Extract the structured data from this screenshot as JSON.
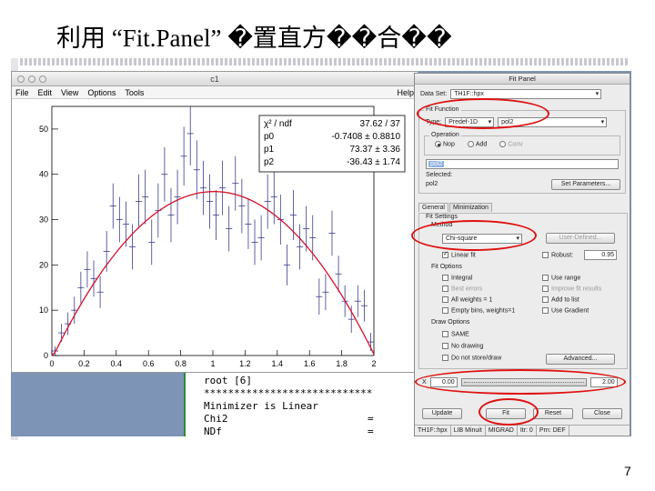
{
  "slide": {
    "title": "利用 “Fit.Panel” �置直方��合��",
    "page_number": "7"
  },
  "canvas_window": {
    "title": "c1",
    "menu": [
      "File",
      "Edit",
      "View",
      "Options",
      "Tools"
    ],
    "help": "Help"
  },
  "stats_box": {
    "rows": [
      {
        "label": "χ² / ndf",
        "value": "37.62 / 37"
      },
      {
        "label": "p0",
        "value": "-0.7408 ± 0.8810"
      },
      {
        "label": "p1",
        "value": "73.37 ± 3.36"
      },
      {
        "label": "p2",
        "value": "-36.43 ± 1.74"
      }
    ]
  },
  "chart_data": {
    "type": "scatter",
    "title": "",
    "xlabel": "",
    "ylabel": "",
    "xlim": [
      0,
      2
    ],
    "ylim": [
      0,
      55
    ],
    "x_ticks": [
      "0",
      "0.2",
      "0.4",
      "0.6",
      "0.8",
      "1",
      "1.2",
      "1.4",
      "1.6",
      "1.8",
      "2"
    ],
    "y_ticks": [
      "0",
      "10",
      "20",
      "30",
      "40",
      "50"
    ],
    "series": [
      {
        "x": [
          0.02,
          0.06,
          0.1,
          0.14,
          0.18,
          0.22,
          0.26,
          0.3,
          0.34,
          0.38,
          0.42,
          0.46,
          0.5,
          0.54,
          0.58,
          0.62,
          0.66,
          0.7,
          0.74,
          0.78,
          0.82,
          0.86,
          0.9,
          0.94,
          0.98,
          1.02,
          1.06,
          1.1,
          1.14,
          1.18,
          1.22,
          1.26,
          1.3,
          1.34,
          1.38,
          1.42,
          1.46,
          1.5,
          1.54,
          1.58,
          1.62,
          1.66,
          1.7,
          1.74,
          1.78,
          1.82,
          1.86,
          1.9,
          1.94,
          1.98
        ],
        "y": [
          1,
          5,
          7,
          10,
          15,
          19,
          17,
          14,
          23,
          33,
          30,
          29,
          24,
          34,
          35,
          25,
          32,
          40,
          31,
          35,
          44,
          49,
          41,
          37,
          34,
          31,
          37,
          28,
          38,
          33,
          29,
          25,
          26,
          34,
          35,
          30,
          20,
          31,
          24,
          28,
          26,
          13,
          14,
          27,
          18,
          12,
          8,
          12,
          11,
          3
        ],
        "err": [
          1,
          2,
          2.5,
          3,
          3.5,
          4,
          4,
          3.5,
          4.5,
          5,
          5,
          5,
          5,
          6,
          6,
          5,
          6,
          6,
          6,
          6,
          6.5,
          7,
          6.5,
          6,
          6,
          5.5,
          6,
          5,
          6,
          6,
          5.5,
          5,
          5,
          6,
          6,
          5.5,
          4.5,
          5.5,
          5,
          5,
          5,
          4,
          4,
          5,
          4,
          3.5,
          3,
          3.5,
          3.5,
          2
        ]
      }
    ],
    "fit_curve": {
      "p0": -0.7408,
      "p1": 73.37,
      "p2": -36.43
    }
  },
  "terminal": {
    "lines": [
      "root [6]",
      "****************************",
      "Minimizer is Linear",
      "Chi2",
      "NDf"
    ],
    "eq": "="
  },
  "fit_panel": {
    "window_title": "Fit Panel",
    "data_set_label": "Data Set:",
    "data_set_value": "TH1F::hpx",
    "fit_function_label": "Fit Function",
    "type_label": "Type:",
    "type_value": "Predef-1D",
    "func_value": "pol2",
    "operation_label": "Operation",
    "op_nop": "Nop",
    "op_add": "Add",
    "op_conv": "Conv",
    "formula_value": "pol2",
    "selected_label": "Selected:",
    "selected_value": "pol2",
    "set_params_label": "Set Parameters...",
    "tab_general": "General",
    "tab_minimization": "Minimization",
    "fit_settings_label": "Fit Settings",
    "method_label": "Method",
    "method_value": "Chi-square",
    "user_defined_label": "User-Defined...",
    "linear_fit": "Linear fit",
    "robust": "Robust:",
    "robust_value": "0.95",
    "fit_options_label": "Fit Options",
    "opt_integral": "Integral",
    "opt_use_range": "Use range",
    "opt_best_errors": "Best errors",
    "opt_improve": "Improve fit results",
    "opt_all_weights": "All weights = 1",
    "opt_add_list": "Add to list",
    "opt_empty_bins": "Empty bins, weights=1",
    "opt_use_gradient": "Use Gradient",
    "draw_options_label": "Draw Options",
    "draw_same": "SAME",
    "draw_no_drawing": "No drawing",
    "draw_do_not_store": "Do not store/draw",
    "advanced_label": "Advanced...",
    "x_label": "X",
    "x_min": "0.00",
    "x_max": "2.00",
    "update_label": "Update",
    "fit_label": "Fit",
    "reset_label": "Reset",
    "close_label": "Close",
    "status": [
      "TH1F::hpx",
      "LIB Minuit",
      "MIGRAD",
      "Itr: 0",
      "Prn: DEF"
    ]
  },
  "colors": {
    "fit_curve": "#d8102a",
    "data_points": "#3a3a8c",
    "highlight_circles": "#e01010",
    "desktop": "#7d94b6"
  }
}
